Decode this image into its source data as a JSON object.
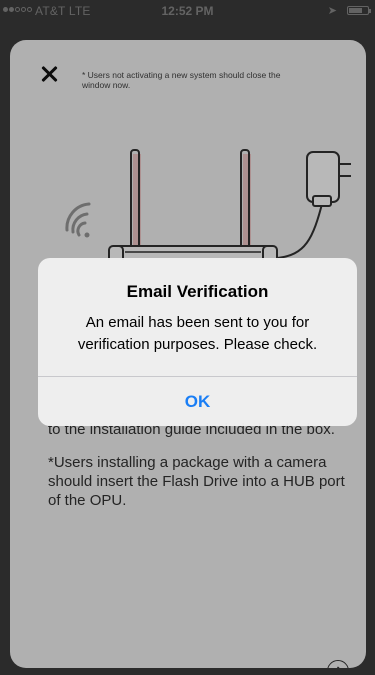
{
  "status_bar": {
    "carrier": "AT&T  LTE",
    "time": "12:52 PM"
  },
  "card": {
    "note": "* Users not activating a new system should close the window now.",
    "body_line1": "to the installation guide included in the box.",
    "body_line2": "*Users installing a package with a camera should insert the Flash Drive into a HUB port of the OPU."
  },
  "alert": {
    "title": "Email Verification",
    "message": "An email has been sent to you for verification purposes. Please check.",
    "ok_label": "OK"
  },
  "colors": {
    "accent": "#1a7ef5",
    "router_highlight": "#f2c9c9"
  },
  "icons": {
    "close": "close-icon",
    "next": "arrow-right-circle-icon",
    "wifi": "wifi-icon",
    "router": "router-illustration",
    "adapter": "power-adapter-illustration"
  }
}
